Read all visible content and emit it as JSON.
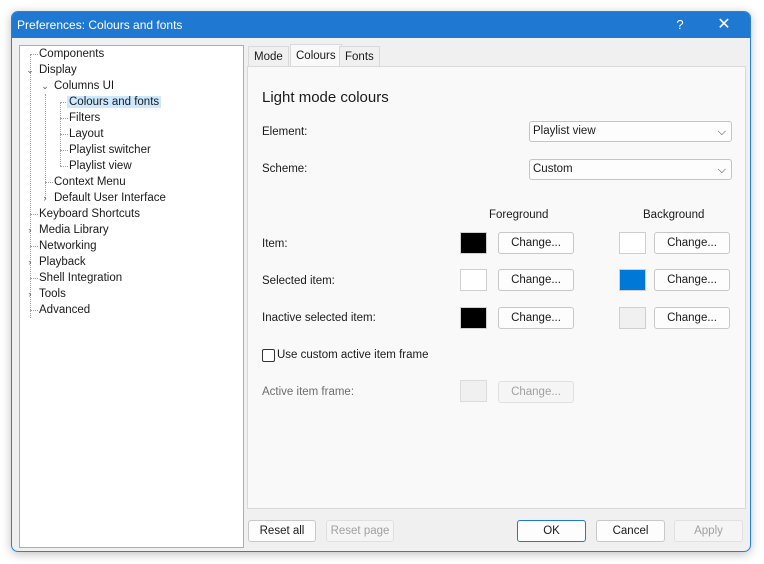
{
  "window": {
    "title": "Preferences: Colours and fonts",
    "help_label": "?",
    "close_label": "✕"
  },
  "tree": {
    "items": [
      {
        "label": "Components"
      },
      {
        "label": "Display"
      },
      {
        "label": "Columns UI"
      },
      {
        "label": "Colours and fonts"
      },
      {
        "label": "Filters"
      },
      {
        "label": "Layout"
      },
      {
        "label": "Playlist switcher"
      },
      {
        "label": "Playlist view"
      },
      {
        "label": "Context Menu"
      },
      {
        "label": "Default User Interface"
      },
      {
        "label": "Keyboard Shortcuts"
      },
      {
        "label": "Media Library"
      },
      {
        "label": "Networking"
      },
      {
        "label": "Playback"
      },
      {
        "label": "Shell Integration"
      },
      {
        "label": "Tools"
      },
      {
        "label": "Advanced"
      }
    ],
    "selected": "Colours and fonts"
  },
  "tabs": [
    {
      "label": "Mode"
    },
    {
      "label": "Colours"
    },
    {
      "label": "Fonts"
    }
  ],
  "active_tab": "Colours",
  "panel": {
    "title": "Light mode colours",
    "element_label": "Element:",
    "element_value": "Playlist view",
    "scheme_label": "Scheme:",
    "scheme_value": "Custom",
    "foreground_header": "Foreground",
    "background_header": "Background",
    "rows": [
      {
        "label": "Item:",
        "fg": "#000000",
        "bg": "#ffffff",
        "fg_button": "Change...",
        "bg_button": "Change..."
      },
      {
        "label": "Selected item:",
        "fg": "#ffffff",
        "bg": "#0078d7",
        "fg_button": "Change...",
        "bg_button": "Change..."
      },
      {
        "label": "Inactive selected item:",
        "fg": "#000000",
        "bg": "#f0f0f0",
        "fg_button": "Change...",
        "bg_button": "Change..."
      }
    ],
    "custom_frame_label": "Use custom active item frame",
    "custom_frame_checked": false,
    "active_frame_label": "Active item frame:",
    "active_frame_button": "Change...",
    "active_frame_color": "#f0f0f0"
  },
  "footer": {
    "reset_all": "Reset all",
    "reset_page": "Reset page",
    "ok": "OK",
    "cancel": "Cancel",
    "apply": "Apply"
  },
  "colors": {
    "accent": "#1f78d1",
    "selection": "#cce8ff"
  }
}
